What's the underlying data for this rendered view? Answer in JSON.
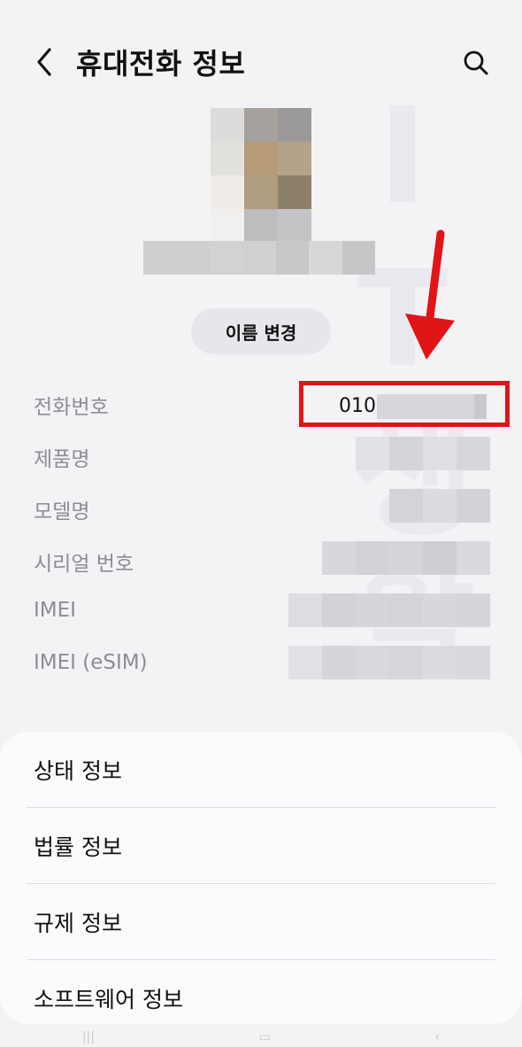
{
  "header": {
    "title": "휴대전화 정보",
    "back_icon": "chevron-left-icon",
    "search_icon": "search-icon"
  },
  "profile": {
    "rename_label": "이름 변경"
  },
  "info": {
    "rows": [
      {
        "label": "전화번호",
        "value": "010-"
      },
      {
        "label": "제품명"
      },
      {
        "label": "모델명"
      },
      {
        "label": "시리얼 번호"
      },
      {
        "label": "IMEI"
      },
      {
        "label": "IMEI (eSIM)"
      }
    ]
  },
  "menu": {
    "items": [
      {
        "label": "상태 정보"
      },
      {
        "label": "법률 정보"
      },
      {
        "label": "규제 정보"
      },
      {
        "label": "소프트웨어 정보"
      }
    ]
  },
  "colors": {
    "background": "#f3f3f6",
    "highlight_red": "#e11416",
    "card": "#fbfbfd"
  }
}
